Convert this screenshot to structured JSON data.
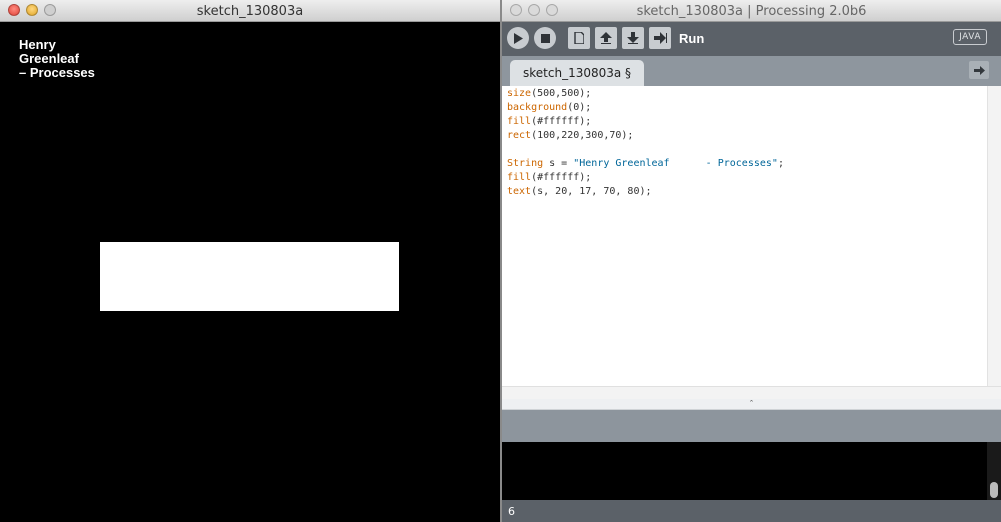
{
  "sketch_window": {
    "title": "sketch_130803a",
    "canvas_text": "Henry\nGreenleaf\n– Processes"
  },
  "pde_window": {
    "title": "sketch_130803a | Processing 2.0b6",
    "toolbar": {
      "run_label": "Run",
      "mode": "JAVA",
      "buttons": [
        "run-icon",
        "stop-icon",
        "new-icon",
        "open-icon",
        "save-icon",
        "export-icon"
      ]
    },
    "tabs": [
      {
        "label": "sketch_130803a §"
      }
    ],
    "code_lines": [
      "size(500,500);",
      "background(0);",
      "fill(#ffffff);",
      "rect(100,220,300,70);",
      "",
      "String s = \"Henry Greenleaf      - Processes\";",
      "fill(#ffffff);",
      "text(s, 20, 17, 70, 80);"
    ],
    "divider_glyph": "ˆ",
    "status_line_number": "6"
  },
  "colors": {
    "toolbar_bg": "#5b6168",
    "keyword": "#cc6600",
    "string": "#006699"
  }
}
